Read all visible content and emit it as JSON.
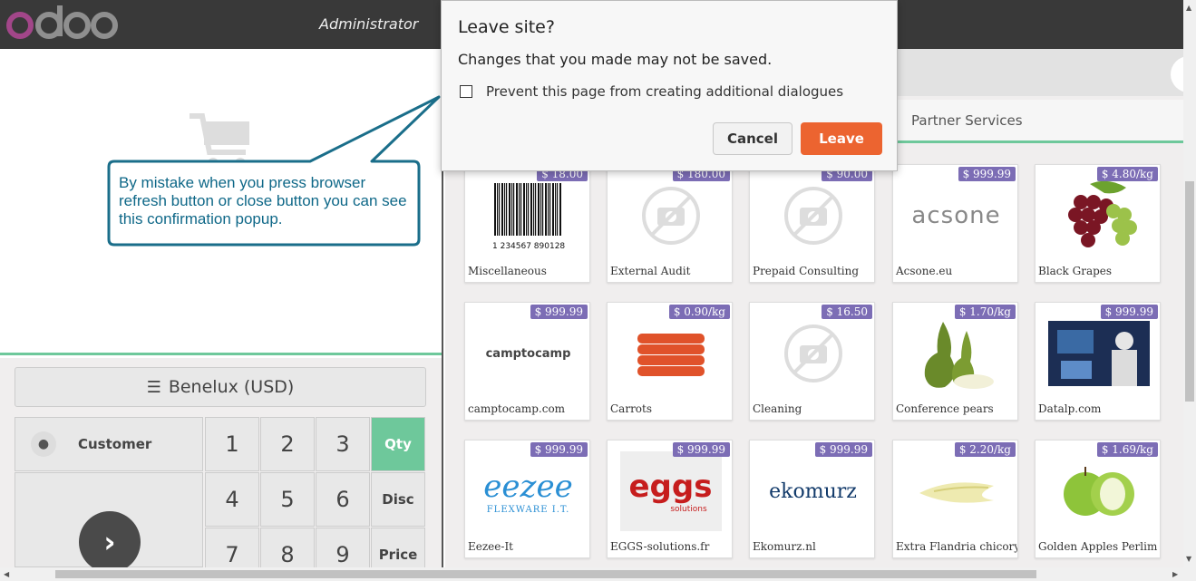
{
  "topbar": {
    "logo_text": "odoo",
    "user": "Administrator"
  },
  "left": {
    "pricelist_label": "Benelux (USD)",
    "customer_label": "Customer",
    "numpad": [
      "1",
      "2",
      "3",
      "4",
      "5",
      "6",
      "7",
      "8",
      "9"
    ],
    "modes": [
      "Qty",
      "Disc",
      "Price"
    ],
    "active_mode": "Qty"
  },
  "categories": {
    "partner_services": "Partner Services"
  },
  "products": [
    {
      "name": "Miscellaneous",
      "price": "$ 18.00",
      "img": "barcode"
    },
    {
      "name": "External Audit",
      "price": "$ 180.00",
      "img": "camera-placeholder"
    },
    {
      "name": "Prepaid Consulting",
      "price": "$ 90.00",
      "img": "camera-placeholder"
    },
    {
      "name": "Acsone.eu",
      "price": "$ 999.99",
      "img": "acsone-logo"
    },
    {
      "name": "Black Grapes",
      "price": "$ 4.80/kg",
      "img": "grapes"
    },
    {
      "name": "camptocamp.com",
      "price": "$ 999.99",
      "img": "camptocamp-logo"
    },
    {
      "name": "Carrots",
      "price": "$ 0.90/kg",
      "img": "carrots"
    },
    {
      "name": "Cleaning",
      "price": "$ 16.50",
      "img": "camera-placeholder"
    },
    {
      "name": "Conference pears",
      "price": "$ 1.70/kg",
      "img": "pears"
    },
    {
      "name": "Datalp.com",
      "price": "$ 999.99",
      "img": "datalp-photo"
    },
    {
      "name": "Eezee-It",
      "price": "$ 999.99",
      "img": "eezee-logo"
    },
    {
      "name": "EGGS-solutions.fr",
      "price": "$ 999.99",
      "img": "eggs-logo"
    },
    {
      "name": "Ekomurz.nl",
      "price": "$ 999.99",
      "img": "ekomurz-logo"
    },
    {
      "name": "Extra Flandria chicory",
      "price": "$ 2.20/kg",
      "img": "chicory"
    },
    {
      "name": "Golden Apples Perlim",
      "price": "$ 1.69/kg",
      "img": "apples"
    }
  ],
  "product_logos": {
    "acsone": "acsone",
    "camptocamp": "camptocamp",
    "eezee": "eezee",
    "eezee_sub": "FLEXWARE I.T.",
    "eggs": "eggs",
    "eggs_sub": "solutions",
    "ekomurz": "ekomurz",
    "barcode_digits": "1 234567 890128 >"
  },
  "dialog": {
    "title": "Leave site?",
    "message": "Changes that you made may not be saved.",
    "checkbox_label": "Prevent this page from creating additional dialogues",
    "cancel": "Cancel",
    "leave": "Leave"
  },
  "callout": {
    "text": "By mistake when you press browser refresh button or close button you can see this confirmation popup."
  },
  "colors": {
    "accent_green": "#6ec89b",
    "price_tag": "#7c6db5",
    "leave_button": "#ec6430",
    "callout_text": "#0f6888",
    "callout_border": "#1a6e8a"
  }
}
